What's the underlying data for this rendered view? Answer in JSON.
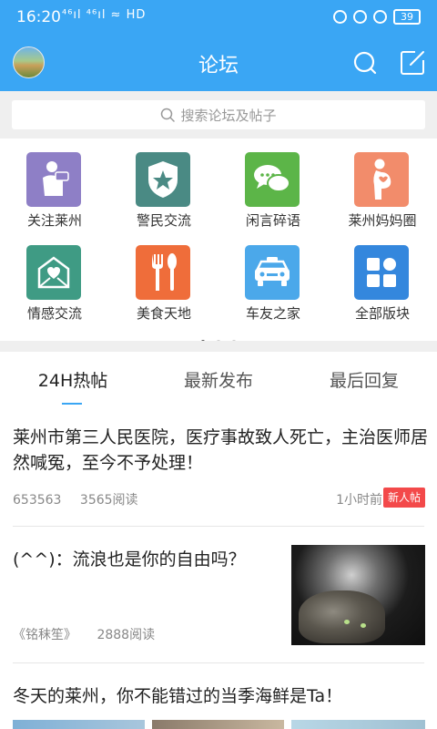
{
  "status_bar": {
    "time": "16:20",
    "network": "⁴⁶ıl ⁴⁶ıl ≈ HD",
    "battery": "39"
  },
  "header": {
    "title": "论坛"
  },
  "search": {
    "placeholder": "搜索论坛及帖子"
  },
  "categories": [
    {
      "label": "关注莱州",
      "color": "#8e7fc6",
      "icon": "person-news-icon"
    },
    {
      "label": "警民交流",
      "color": "#4a8a84",
      "icon": "police-badge-icon"
    },
    {
      "label": "闲言碎语",
      "color": "#5cb548",
      "icon": "chat-bubbles-icon"
    },
    {
      "label": "莱州妈妈圈",
      "color": "#f28c6b",
      "icon": "pregnant-icon"
    },
    {
      "label": "情感交流",
      "color": "#3f9b84",
      "icon": "love-letter-icon"
    },
    {
      "label": "美食天地",
      "color": "#ef6d3a",
      "icon": "fork-spoon-icon"
    },
    {
      "label": "车友之家",
      "color": "#4ba8ea",
      "icon": "car-icon"
    },
    {
      "label": "全部版块",
      "color": "#3487dd",
      "icon": "grid-blocks-icon"
    }
  ],
  "tabs": [
    {
      "label": "24H热帖"
    },
    {
      "label": "最新发布"
    },
    {
      "label": "最后回复"
    }
  ],
  "posts": [
    {
      "title": "莱州市第三人民医院，医疗事故致人死亡，主治医师居然喊冤，至今不予处理！",
      "author": "653563",
      "reads": "3565阅读",
      "time": "1小时前",
      "badge": "新人帖"
    },
    {
      "title": "(^^)：流浪也是你的自由吗？",
      "author": "《铭秣笙》",
      "reads": "2888阅读"
    },
    {
      "title": "冬天的莱州，你不能错过的当季海鲜是Ta！"
    }
  ]
}
